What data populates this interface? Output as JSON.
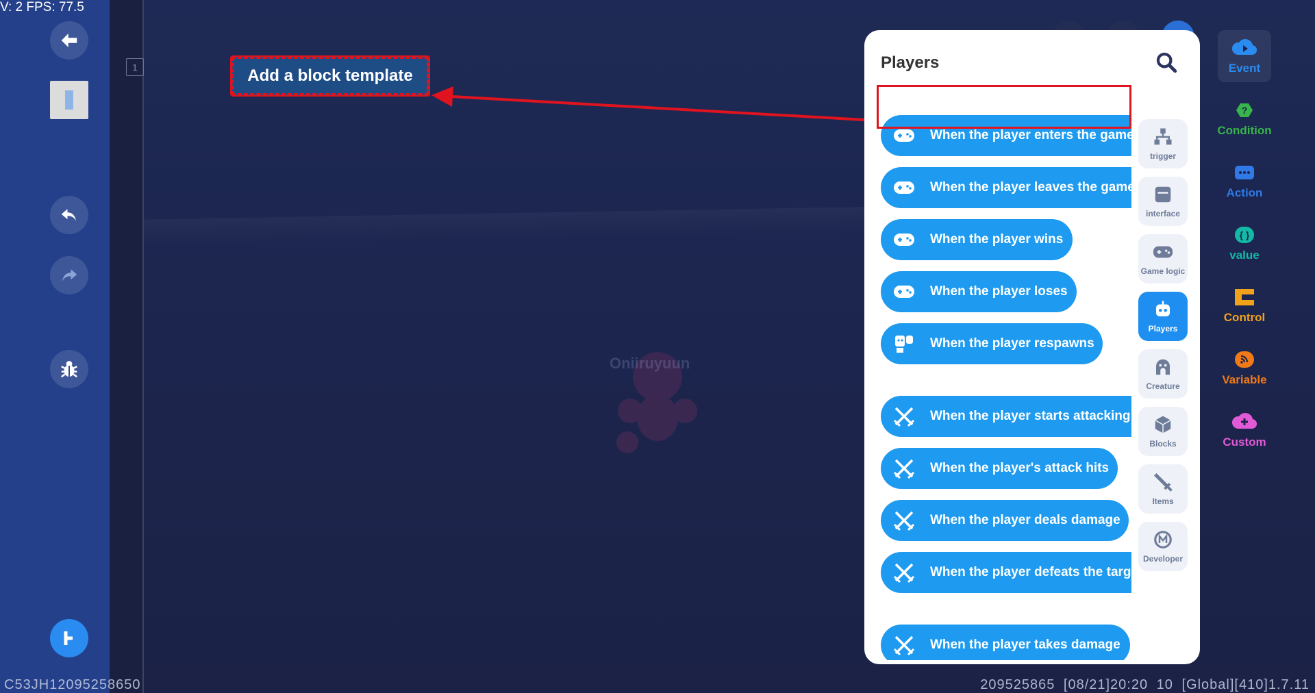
{
  "hud": {
    "fps_text": "V: 2 FPS: 77.5",
    "left_id": "C53JH12095258650",
    "right_info": "209525865   [08/21]20:20 10  [Global][410]1.7.11"
  },
  "workspace": {
    "line_number": "1",
    "watermark_text": "Oniiruyuun"
  },
  "tooltip": {
    "label": "Add a block template"
  },
  "palette": {
    "title": "Players",
    "blocks": [
      {
        "label": "When the player enters the game",
        "icon": "gamepad-icon"
      },
      {
        "label": "When the player leaves the game",
        "icon": "gamepad-icon"
      },
      {
        "label": "When the player wins",
        "icon": "gamepad-icon"
      },
      {
        "label": "When the player loses",
        "icon": "gamepad-icon"
      },
      {
        "label": "When the player respawns",
        "icon": "respawn-icon"
      },
      {
        "label": "When the player starts attacking",
        "icon": "crossed-swords-icon"
      },
      {
        "label": "When the player's attack hits",
        "icon": "crossed-swords-icon"
      },
      {
        "label": "When the player deals damage",
        "icon": "crossed-swords-icon"
      },
      {
        "label": "When the player defeats the target",
        "icon": "crossed-swords-icon"
      },
      {
        "label": "When the player takes damage",
        "icon": "crossed-swords-icon"
      }
    ],
    "subcategories": [
      {
        "label": "trigger",
        "icon": "hierarchy-icon"
      },
      {
        "label": "interface",
        "icon": "window-icon"
      },
      {
        "label": "Game logic",
        "icon": "gamepad-icon"
      },
      {
        "label": "Players",
        "icon": "robot-icon",
        "active": true
      },
      {
        "label": "Creature",
        "icon": "ghost-icon"
      },
      {
        "label": "Blocks",
        "icon": "cube-icon"
      },
      {
        "label": "Items",
        "icon": "sword-icon"
      },
      {
        "label": "Developer",
        "icon": "developer-icon"
      }
    ]
  },
  "categories": [
    {
      "label": "Event",
      "color": "#2a8cf0",
      "icon": "event-icon"
    },
    {
      "label": "Condition",
      "color": "#37b54a",
      "icon": "condition-icon"
    },
    {
      "label": "Action",
      "color": "#2f7ae6",
      "icon": "action-icon"
    },
    {
      "label": "value",
      "color": "#13b8a6",
      "icon": "value-icon"
    },
    {
      "label": "Control",
      "color": "#f2a11b",
      "icon": "control-icon"
    },
    {
      "label": "Variable",
      "color": "#f07a18",
      "icon": "variable-icon"
    },
    {
      "label": "Custom",
      "color": "#e15ad6",
      "icon": "custom-icon"
    }
  ],
  "colors": {
    "block_blue": "#1e9bf0",
    "highlight_red": "#e0141e",
    "rail_blue": "#24408a"
  }
}
